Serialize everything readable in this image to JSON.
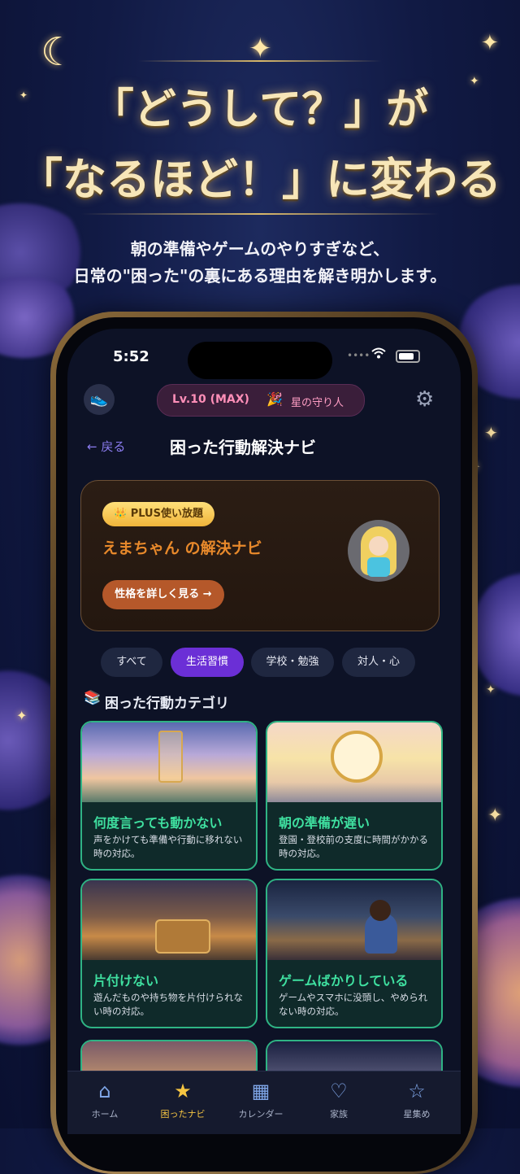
{
  "promo": {
    "headline_line1": "「どうして？」が",
    "headline_line2": "「なるほど！」に変わる",
    "subtext_line1": "朝の準備やゲームのやりすぎなど、",
    "subtext_line2": "日常の\"困った\"の裏にある理由を解き明かします。"
  },
  "status_bar": {
    "time": "5:52"
  },
  "header": {
    "level_badge": "Lv.10 (MAX)",
    "level_emoji": "🎉",
    "level_title": "星の守り人",
    "back_label": "← 戻る",
    "page_title": "困った行動解決ナビ"
  },
  "plus_card": {
    "badge": "👑 PLUS使い放題",
    "title": "えまちゃん の解決ナビ",
    "button": "性格を詳しく見る →"
  },
  "filters": [
    {
      "label": "すべて",
      "active": false
    },
    {
      "label": "生活習慣",
      "active": true
    },
    {
      "label": "学校・勉強",
      "active": false
    },
    {
      "label": "対人・心",
      "active": false
    }
  ],
  "section": {
    "icon": "📚",
    "title": "困った行動カテゴリ"
  },
  "categories": [
    {
      "title": "何度言っても動かない",
      "desc": "声をかけても準備や行動に移れない時の対応。"
    },
    {
      "title": "朝の準備が遅い",
      "desc": "登園・登校前の支度に時間がかかる時の対応。"
    },
    {
      "title": "片付けない",
      "desc": "遊んだものや持ち物を片付けられない時の対応。"
    },
    {
      "title": "ゲームばかりしている",
      "desc": "ゲームやスマホに没頭し、やめられない時の対応。"
    }
  ],
  "tabs": [
    {
      "label": "ホーム",
      "icon": "home-icon",
      "active": false
    },
    {
      "label": "困ったナビ",
      "icon": "star-icon",
      "active": true
    },
    {
      "label": "カレンダー",
      "icon": "calendar-icon",
      "active": false
    },
    {
      "label": "家族",
      "icon": "heart-icon",
      "active": false
    },
    {
      "label": "星集め",
      "icon": "star-outline-icon",
      "active": false
    }
  ],
  "colors": {
    "accent_green": "#3fe0a0",
    "active_chip": "#6b2fd6",
    "gold": "#f5c542",
    "orange_title": "#e8892b"
  }
}
